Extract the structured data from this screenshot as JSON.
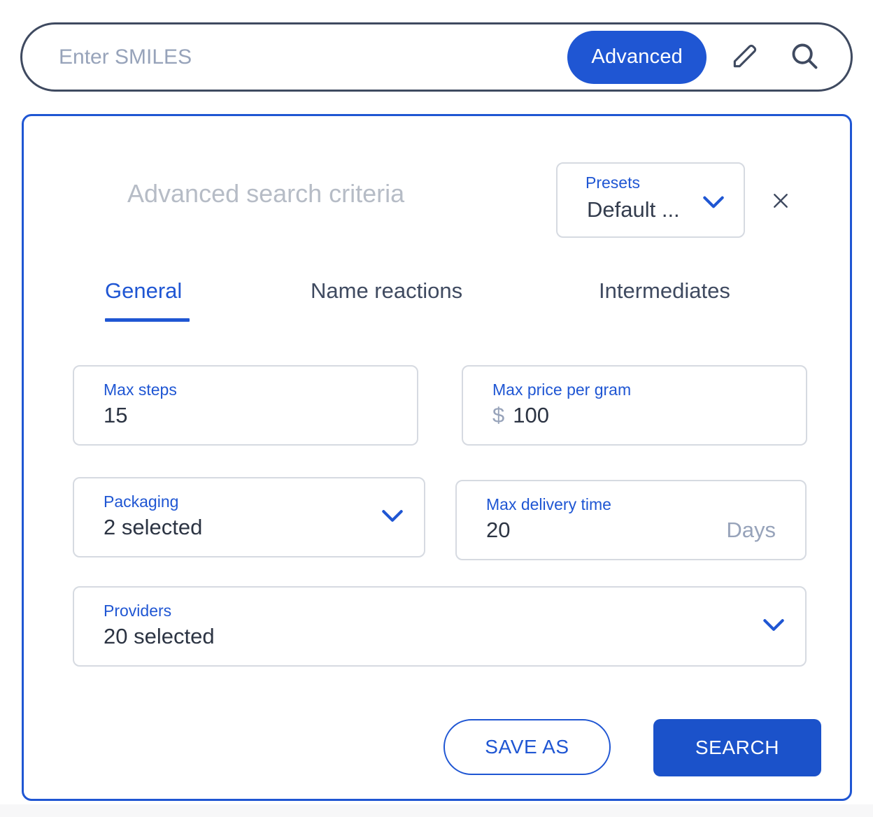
{
  "search": {
    "placeholder": "Enter SMILES",
    "value": "",
    "advanced_label": "Advanced",
    "edit_icon": "pencil-icon",
    "search_icon": "search-icon"
  },
  "panel": {
    "title": "Advanced search criteria",
    "close_icon": "close-icon",
    "presets": {
      "label": "Presets",
      "value": "Default ...",
      "chevron_icon": "chevron-down-icon"
    },
    "tabs": [
      {
        "label": "General",
        "active": true
      },
      {
        "label": "Name reactions",
        "active": false
      },
      {
        "label": "Intermediates",
        "active": false
      }
    ],
    "fields": {
      "max_steps": {
        "label": "Max steps",
        "value": "15"
      },
      "max_price": {
        "label": "Max price per gram",
        "prefix": "$",
        "value": "100"
      },
      "packaging": {
        "label": "Packaging",
        "value": "2 selected",
        "chevron_icon": "chevron-down-icon"
      },
      "max_delivery": {
        "label": "Max delivery time",
        "value": "20",
        "suffix": "Days"
      },
      "providers": {
        "label": "Providers",
        "value": "20 selected",
        "chevron_icon": "chevron-down-icon"
      }
    },
    "actions": {
      "save_as_label": "SAVE AS",
      "search_label": "SEARCH"
    }
  },
  "colors": {
    "accent_blue": "#1f56d3",
    "search_blue": "#1b52ca",
    "dark_slate": "#3f4a60",
    "muted": "#97a3ba",
    "border_gray": "#d6dae1",
    "title_gray": "#b6bcc6"
  }
}
